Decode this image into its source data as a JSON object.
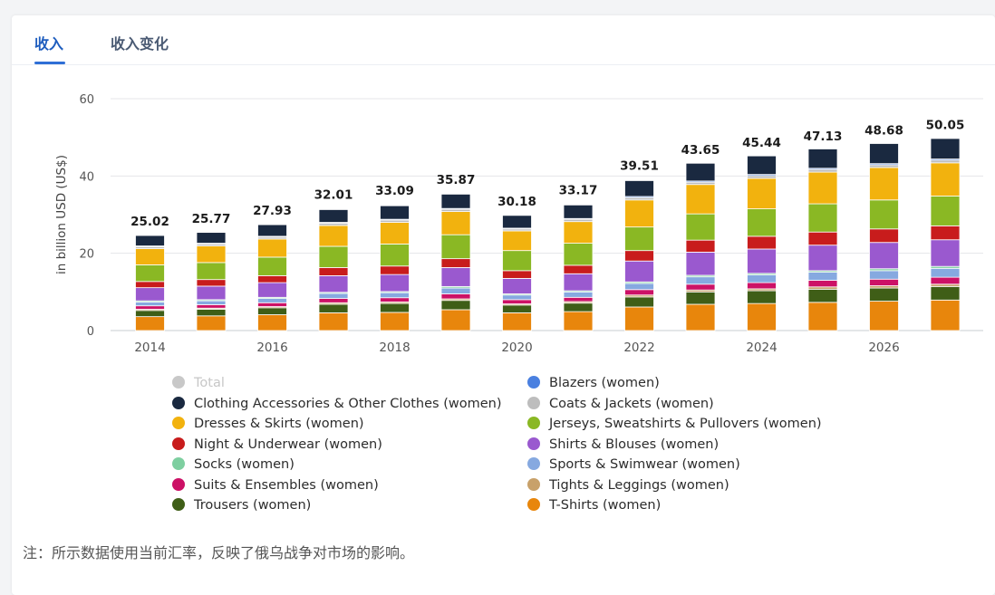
{
  "tabs": [
    {
      "label": "收入",
      "active": true
    },
    {
      "label": "收入变化",
      "active": false
    }
  ],
  "note": "注：所示数据使用当前汇率，反映了俄乌战争对市场的影响。",
  "chart_data": {
    "type": "bar",
    "stacked": true,
    "ylabel": "in billion USD (US$)",
    "ylim": [
      0,
      60
    ],
    "yticks": [
      0,
      20,
      40,
      60
    ],
    "years": [
      2014,
      2015,
      2016,
      2017,
      2018,
      2019,
      2020,
      2021,
      2022,
      2023,
      2024,
      2025,
      2026,
      2027
    ],
    "xtick_labels": [
      "2014",
      "2016",
      "2018",
      "2020",
      "2022",
      "2024",
      "2026"
    ],
    "totals": [
      25.02,
      25.77,
      27.93,
      32.01,
      33.09,
      35.87,
      30.18,
      33.17,
      39.51,
      43.65,
      45.44,
      47.13,
      48.68,
      50.05
    ],
    "total_labels": [
      "25.02",
      "25.77",
      "27.93",
      "32.01",
      "33.09",
      "35.87",
      "30.18",
      "33.17",
      "39.51",
      "43.65",
      "45.44",
      "47.13",
      "48.68",
      "50.05"
    ],
    "series": [
      {
        "name": "T-Shirts (women)",
        "color": "#e8860c",
        "values": [
          3.6,
          3.8,
          4.1,
          4.6,
          4.7,
          5.4,
          4.6,
          4.9,
          6.1,
          6.8,
          7.0,
          7.3,
          7.6,
          7.9
        ]
      },
      {
        "name": "Trousers (women)",
        "color": "#3f5e17",
        "values": [
          1.6,
          1.7,
          1.8,
          2.2,
          2.3,
          2.4,
          2.0,
          2.2,
          2.6,
          3.2,
          3.3,
          3.4,
          3.4,
          3.5
        ]
      },
      {
        "name": "Tights & Leggings (women)",
        "color": "#c8a16a",
        "values": [
          0.3,
          0.3,
          0.3,
          0.4,
          0.4,
          0.4,
          0.3,
          0.4,
          0.5,
          0.5,
          0.5,
          0.6,
          0.6,
          0.6
        ]
      },
      {
        "name": "Suits & Ensembles (women)",
        "color": "#cc1166",
        "values": [
          0.9,
          0.9,
          1.0,
          1.1,
          1.1,
          1.3,
          1.1,
          1.1,
          1.4,
          1.5,
          1.6,
          1.7,
          1.7,
          1.8
        ]
      },
      {
        "name": "Sports & Swimwear (women)",
        "color": "#86a9e0",
        "values": [
          1.0,
          1.0,
          1.1,
          1.3,
          1.3,
          1.5,
          1.2,
          1.4,
          1.6,
          1.9,
          2.0,
          2.1,
          2.2,
          2.3
        ]
      },
      {
        "name": "Socks (women)",
        "color": "#7ecfa0",
        "values": [
          0.3,
          0.3,
          0.3,
          0.3,
          0.3,
          0.4,
          0.3,
          0.3,
          0.4,
          0.4,
          0.4,
          0.4,
          0.5,
          0.5
        ]
      },
      {
        "name": "Shirts & Blouses (women)",
        "color": "#9a59cf",
        "values": [
          3.4,
          3.5,
          3.8,
          4.3,
          4.4,
          4.9,
          4.0,
          4.4,
          5.4,
          6.0,
          6.3,
          6.6,
          6.8,
          6.9
        ]
      },
      {
        "name": "Night & Underwear (women)",
        "color": "#c81c1c",
        "values": [
          1.6,
          1.7,
          1.8,
          2.1,
          2.2,
          2.3,
          2.0,
          2.2,
          2.7,
          3.1,
          3.3,
          3.4,
          3.5,
          3.6
        ]
      },
      {
        "name": "Jerseys, Sweatshirts & Pullovers (women)",
        "color": "#8ab824",
        "values": [
          4.3,
          4.4,
          4.8,
          5.5,
          5.7,
          6.2,
          5.2,
          5.7,
          6.1,
          6.8,
          7.1,
          7.3,
          7.5,
          7.7
        ]
      },
      {
        "name": "Dresses & Skirts (women)",
        "color": "#f2b20e",
        "values": [
          4.2,
          4.3,
          4.7,
          5.4,
          5.6,
          6.0,
          5.1,
          5.6,
          7.0,
          7.6,
          7.9,
          8.2,
          8.4,
          8.6
        ]
      },
      {
        "name": "Coats & Jackets (women)",
        "color": "#bdbdbd",
        "values": [
          0.5,
          0.5,
          0.5,
          0.6,
          0.6,
          0.6,
          0.5,
          0.6,
          0.6,
          0.6,
          0.7,
          0.7,
          0.7,
          0.7
        ]
      },
      {
        "name": "Blazers (women)",
        "color": "#4a80e0",
        "values": [
          0.2,
          0.2,
          0.2,
          0.2,
          0.2,
          0.2,
          0.2,
          0.2,
          0.3,
          0.3,
          0.3,
          0.3,
          0.3,
          0.3
        ]
      },
      {
        "name": "Clothing Accessories & Other Clothes (women)",
        "color": "#1a2940",
        "values": [
          2.7,
          2.8,
          3.0,
          3.3,
          3.5,
          3.7,
          3.3,
          3.5,
          4.1,
          4.6,
          4.8,
          5.0,
          5.2,
          5.3
        ]
      }
    ],
    "legend": [
      {
        "name": "Total",
        "color": "#c8c8c8",
        "muted": true
      },
      {
        "name": "Blazers (women)",
        "color": "#4a80e0"
      },
      {
        "name": "Clothing Accessories & Other Clothes (women)",
        "color": "#1a2940"
      },
      {
        "name": "Coats & Jackets (women)",
        "color": "#bdbdbd"
      },
      {
        "name": "Dresses & Skirts (women)",
        "color": "#f2b20e"
      },
      {
        "name": "Jerseys, Sweatshirts & Pullovers (women)",
        "color": "#8ab824"
      },
      {
        "name": "Night & Underwear (women)",
        "color": "#c81c1c"
      },
      {
        "name": "Shirts & Blouses (women)",
        "color": "#9a59cf"
      },
      {
        "name": "Socks (women)",
        "color": "#7ecfa0"
      },
      {
        "name": "Sports & Swimwear (women)",
        "color": "#86a9e0"
      },
      {
        "name": "Suits & Ensembles (women)",
        "color": "#cc1166"
      },
      {
        "name": "Tights & Leggings (women)",
        "color": "#c8a16a"
      },
      {
        "name": "Trousers (women)",
        "color": "#3f5e17"
      },
      {
        "name": "T-Shirts (women)",
        "color": "#e8860c"
      }
    ],
    "legend_placement": "bottom",
    "grid": true
  }
}
